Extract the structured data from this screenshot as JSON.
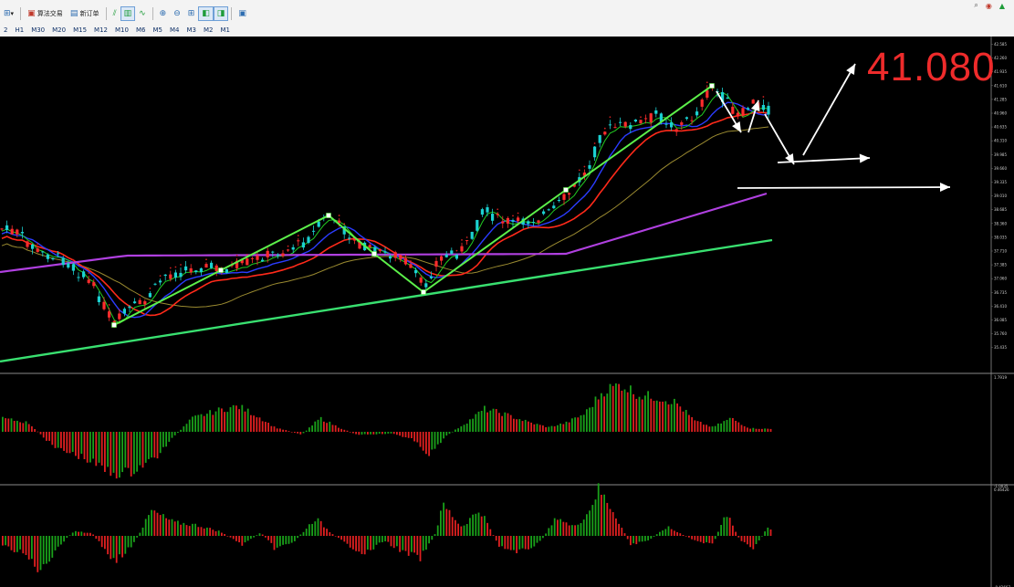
{
  "toolbar": {
    "buttons": [
      {
        "name": "grid-icon",
        "glyph": "⊞"
      },
      {
        "name": "algo-trading-button",
        "label": "算法交易"
      },
      {
        "name": "new-order-button",
        "label": "新订单"
      }
    ],
    "chart_tools": [
      "⫽",
      "▥",
      "∿",
      "⊕",
      "⊖",
      "⊞",
      "◧",
      "◨",
      "▣"
    ],
    "timeframes": [
      "2",
      "H1",
      "M30",
      "M20",
      "M15",
      "M12",
      "M10",
      "M6",
      "M5",
      "M4",
      "M3",
      "M2",
      "M1"
    ]
  },
  "chart": {
    "current_price_label": "41.080",
    "price_axis_labels": [
      "42.585",
      "42.260",
      "41.935",
      "41.610",
      "41.285",
      "40.960",
      "40.635",
      "40.310",
      "39.985",
      "39.660",
      "39.335",
      "39.010",
      "38.685",
      "38.360",
      "38.035",
      "37.710",
      "37.385",
      "37.060",
      "36.735",
      "36.410",
      "36.085",
      "35.760",
      "35.435"
    ],
    "osc1_axis_labels": [
      "1.7919",
      "-1.0035"
    ],
    "osc2_axis_labels": [
      "0.46426",
      "-0.42667"
    ],
    "colors": {
      "background": "#000000",
      "bull_candle": "#1bd1d1",
      "bear_candle": "#ff2c2c",
      "zigzag": "#5cf04a",
      "ma_fast": "#22cc22",
      "ma_blue": "#2b3cff",
      "ma_red": "#ff2a1a",
      "ma_olive": "#9a8a30",
      "ma_purple": "#b040e0",
      "ma_long": "#39e070",
      "arrow": "#ffffff",
      "hist_up": "#1aa01a",
      "hist_down": "#e02020"
    }
  }
}
